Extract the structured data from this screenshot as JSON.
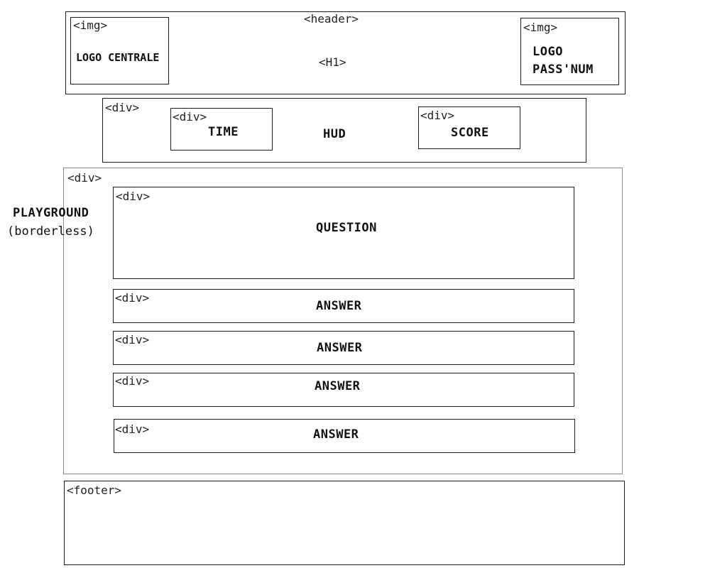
{
  "header": {
    "tag": "<header>",
    "h1_tag": "<H1>",
    "logo_left": {
      "tag": "<img>",
      "label": "LOGO CENTRALE"
    },
    "logo_right": {
      "tag": "<img>",
      "label_line1": "LOGO",
      "label_line2": "PASS'NUM"
    }
  },
  "hud": {
    "tag": "<div>",
    "label": "HUD",
    "time": {
      "tag": "<div>",
      "label": "TIME"
    },
    "score": {
      "tag": "<div>",
      "label": "SCORE"
    }
  },
  "playground": {
    "tag": "<div>",
    "label": "PLAYGROUND",
    "note": "(borderless)",
    "question": {
      "tag": "<div>",
      "label": "QUESTION"
    },
    "answers": [
      {
        "tag": "<div>",
        "label": "ANSWER"
      },
      {
        "tag": "<div>",
        "label": "ANSWER"
      },
      {
        "tag": "<div>",
        "label": "ANSWER"
      },
      {
        "tag": "<div>",
        "label": "ANSWER"
      }
    ]
  },
  "footer": {
    "tag": "<footer>"
  }
}
